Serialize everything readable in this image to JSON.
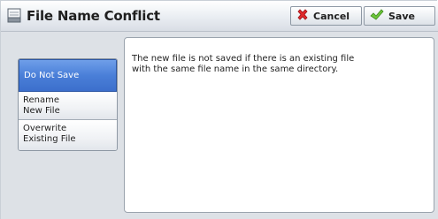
{
  "dialog": {
    "title": "File Name Conflict",
    "title_icon": "file-conflict-icon",
    "cancel_label": "Cancel",
    "cancel_icon": "red-x-icon",
    "save_label": "Save",
    "save_icon": "green-check-icon"
  },
  "options": [
    {
      "label": "Do Not Save",
      "selected": true
    },
    {
      "label": "Rename\nNew File",
      "selected": false
    },
    {
      "label": "Overwrite\nExisting File",
      "selected": false
    }
  ],
  "message": "The new file is not saved if there is an existing file\nwith the same file name in the same directory.",
  "colors": {
    "selected": "#4a7fd8",
    "cancel_icon": "#e0292b",
    "save_icon": "#6cc63a"
  }
}
